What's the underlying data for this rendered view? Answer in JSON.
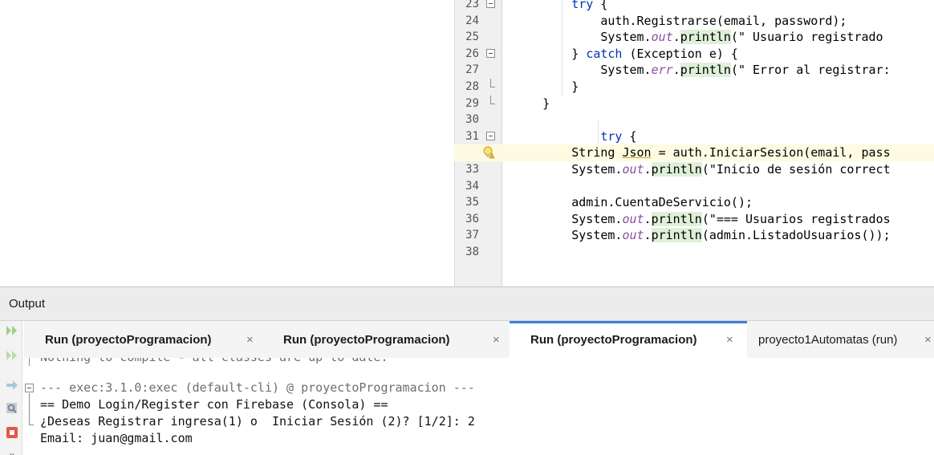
{
  "editor": {
    "lines": [
      {
        "n": "23",
        "tokens": [
          {
            "t": "        "
          },
          {
            "t": "try",
            "c": "kw"
          },
          {
            "t": " {"
          }
        ]
      },
      {
        "n": "24",
        "tokens": [
          {
            "t": "            auth.Registrarse(email, password);"
          }
        ]
      },
      {
        "n": "25",
        "tokens": [
          {
            "t": "            System."
          },
          {
            "t": "out",
            "c": "it"
          },
          {
            "t": "."
          },
          {
            "t": "println",
            "c": "mt"
          },
          {
            "t": "(\" Usuario registrado "
          }
        ]
      },
      {
        "n": "26",
        "tokens": [
          {
            "t": "        } "
          },
          {
            "t": "catch",
            "c": "kw"
          },
          {
            "t": " (Exception e) {"
          }
        ]
      },
      {
        "n": "27",
        "tokens": [
          {
            "t": "            System."
          },
          {
            "t": "err",
            "c": "it"
          },
          {
            "t": "."
          },
          {
            "t": "println",
            "c": "mt"
          },
          {
            "t": "(\" Error al registrar:"
          }
        ]
      },
      {
        "n": "28",
        "tokens": [
          {
            "t": "        }"
          }
        ]
      },
      {
        "n": "29",
        "tokens": [
          {
            "t": "    }"
          }
        ]
      },
      {
        "n": "30",
        "tokens": [
          {
            "t": ""
          }
        ]
      },
      {
        "n": "31",
        "tokens": [
          {
            "t": "            "
          },
          {
            "t": "try",
            "c": "kw"
          },
          {
            "t": " {"
          }
        ]
      },
      {
        "n": "",
        "tokens": [
          {
            "t": "        String "
          },
          {
            "t": "Json",
            "c": "ul"
          },
          {
            "t": " = auth.IniciarSesion(email, pass"
          }
        ]
      },
      {
        "n": "33",
        "tokens": [
          {
            "t": "        System."
          },
          {
            "t": "out",
            "c": "it"
          },
          {
            "t": "."
          },
          {
            "t": "println",
            "c": "mt"
          },
          {
            "t": "(\"Inicio de sesión correct"
          }
        ]
      },
      {
        "n": "34",
        "tokens": [
          {
            "t": ""
          }
        ]
      },
      {
        "n": "35",
        "tokens": [
          {
            "t": "        admin.CuentaDeServicio();"
          }
        ]
      },
      {
        "n": "36",
        "tokens": [
          {
            "t": "        System."
          },
          {
            "t": "out",
            "c": "it"
          },
          {
            "t": "."
          },
          {
            "t": "println",
            "c": "mt"
          },
          {
            "t": "(\"=== Usuarios registrados"
          }
        ]
      },
      {
        "n": "37",
        "tokens": [
          {
            "t": "        System."
          },
          {
            "t": "out",
            "c": "it"
          },
          {
            "t": "."
          },
          {
            "t": "println",
            "c": "mt"
          },
          {
            "t": "(admin.ListadoUsuarios());"
          }
        ]
      },
      {
        "n": "38",
        "tokens": [
          {
            "t": ""
          }
        ]
      }
    ]
  },
  "output": {
    "title": "Output",
    "tabs": [
      {
        "label": "Run (proyectoProgramacion)",
        "close": "×"
      },
      {
        "label": "Run (proyectoProgramacion)",
        "close": "×"
      },
      {
        "label": "Run (proyectoProgramacion)",
        "close": "×"
      },
      {
        "label": "proyecto1Automatas (run)",
        "close": "×"
      }
    ],
    "console": [
      "Nothing to compile - all classes are up to date.",
      "--- exec:3.1.0:exec (default-cli) @ proyectoProgramacion ---",
      "== Demo Login/Register con Firebase (Consola) ==",
      "¿Deseas Registrar ingresa(1) o  Iniciar Sesión (2)? [1/2]: 2",
      "Email: juan@gmail.com"
    ]
  },
  "colors": {
    "keyword": "#0033b3",
    "static_field": "#8d4ba6",
    "method_highlight": "#dff0d8",
    "active_tab_accent": "#3d7fd8"
  }
}
